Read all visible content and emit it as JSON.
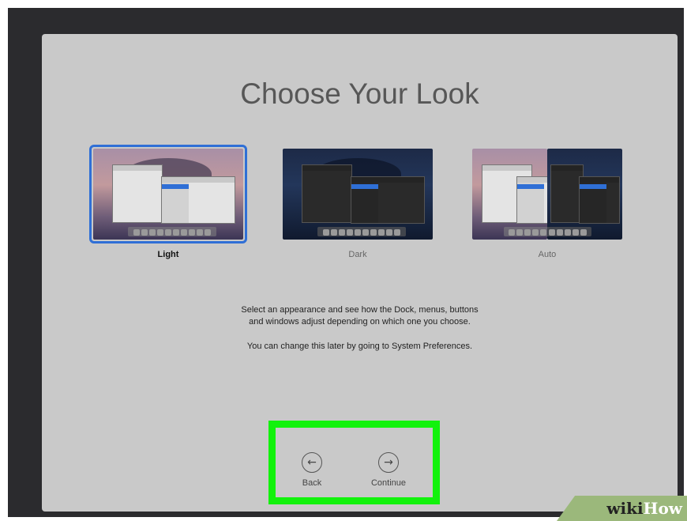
{
  "setup": {
    "title": "Choose Your Look",
    "options": [
      {
        "label": "Light",
        "selected": true
      },
      {
        "label": "Dark",
        "selected": false
      },
      {
        "label": "Auto",
        "selected": false
      }
    ],
    "description_line1": "Select an appearance and see how the Dock, menus, buttons",
    "description_line2": "and windows adjust depending on which one you choose.",
    "description_line3": "You can change this later by going to System Preferences."
  },
  "nav": {
    "back_label": "Back",
    "continue_label": "Continue",
    "back_icon": "arrow-left-circle-icon",
    "continue_icon": "arrow-right-circle-icon"
  },
  "watermark": {
    "part1": "wiki",
    "part2": "How"
  },
  "colors": {
    "selection_border": "#2f6fd6",
    "highlight_box": "#12f20c",
    "window_background": "#c9c9c9"
  }
}
